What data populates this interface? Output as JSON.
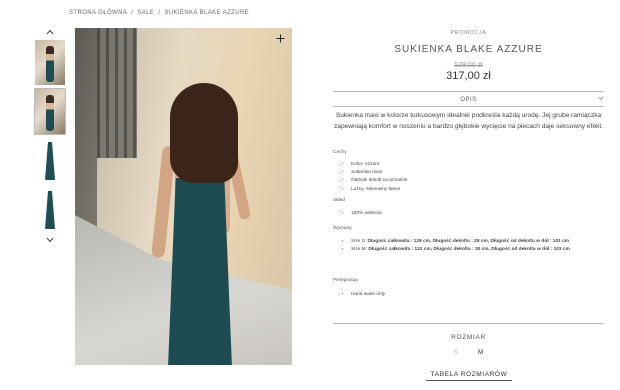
{
  "breadcrumb": [
    "STRONA GŁÓWNA",
    "SALE",
    "SUKIENKA BLAKE AZZURE"
  ],
  "gallery": {
    "up_icon": "chevron-up-icon",
    "down_icon": "chevron-down-icon",
    "zoom_icon": "plus-icon"
  },
  "product": {
    "promo_label": "PROMOCJA",
    "title": "SUKIENKA BLAKE AZZURE",
    "old_price": "529,00 zł",
    "price": "317,00 zł",
    "tab_label": "OPIS",
    "description": "Sukienka maxi w kolorze turkusowym idealnie podkreśla każdą urodę. Jej grube ramiączka zapewniają komfort w noszeniu a bardzo głębokie wycięcie na plecach daje seksowny efekt.",
    "cechy_title": "Cechy",
    "cechy": [
      "Kolor: Azzure",
      "Sukienka maxi",
      "Głęboki dekolt na przodzie",
      "Luźny, seksowny fason"
    ],
    "sklad_title": "Skład",
    "sklad": [
      "100% wiskoza"
    ],
    "wymiary_title": "Wymiary",
    "wymiary": [
      {
        "size": "Size S:",
        "text": "Długość całkowita : 129 cm, Długość dekoltu : 28 cm, Długość od dekoltu w dół : 101 cm"
      },
      {
        "size": "Size M:",
        "text": "Długość całkowita : 131 cm, Długość dekoltu : 30 cm, Długość od dekoltu w dół : 103 cm"
      }
    ],
    "pielegnacja_title": "Pielęgnacja",
    "pielegnacja": [
      "Hand wash only"
    ],
    "size_label": "ROZMIAR",
    "sizes": [
      "S",
      "M"
    ],
    "size_table": "TABELA ROZMIARÓW"
  },
  "colors": {
    "accent_dress": "#1c4b51",
    "text": "#333333",
    "muted": "#999999"
  }
}
